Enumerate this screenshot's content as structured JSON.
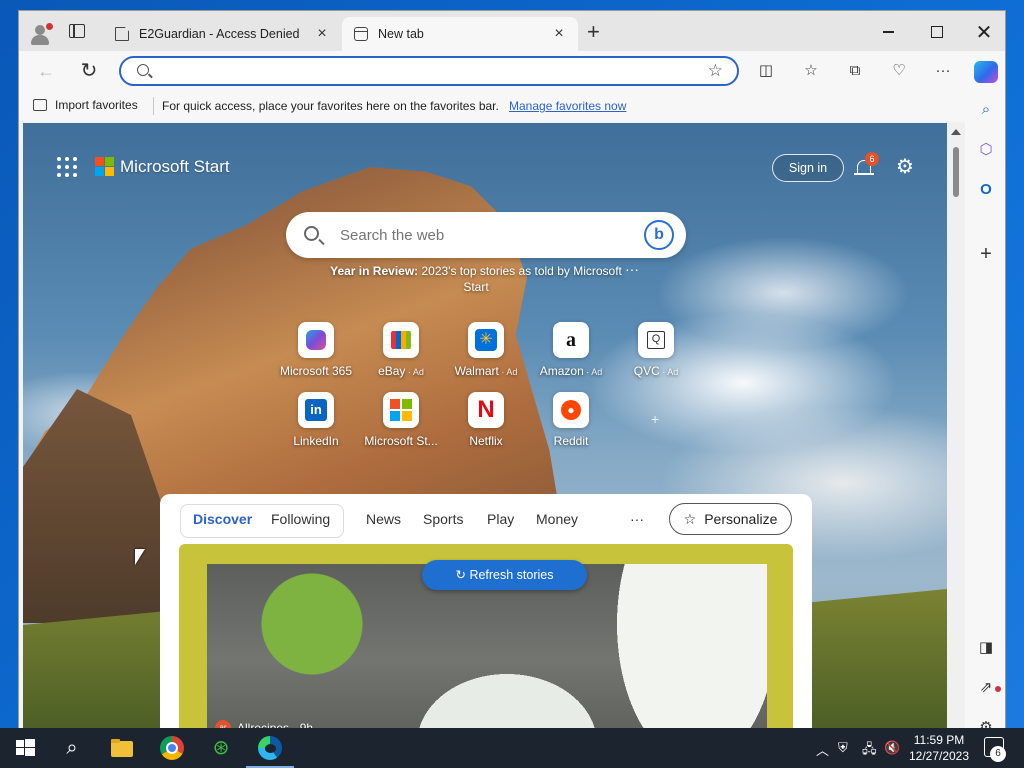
{
  "browser": {
    "tabs": [
      {
        "label": "E2Guardian - Access Denied",
        "active": false
      },
      {
        "label": "New tab",
        "active": true
      }
    ],
    "address_value": "",
    "favorites_bar": {
      "import_label": "Import favorites",
      "hint": "For quick access, place your favorites here on the favorites bar.",
      "manage_link": "Manage favorites now"
    }
  },
  "start_page": {
    "brand": "Microsoft Start",
    "sign_in": "Sign in",
    "notification_count": "6",
    "search_placeholder": "Search the web",
    "year_in_review": {
      "bold": "Year in Review:",
      "text": " 2023's top stories as told by Microsoft Start"
    },
    "quick_links": [
      {
        "label": "Microsoft 365",
        "ad": ""
      },
      {
        "label": "eBay",
        "ad": " · Ad"
      },
      {
        "label": "Walmart",
        "ad": " · Ad"
      },
      {
        "label": "Amazon",
        "ad": " · Ad"
      },
      {
        "label": "QVC",
        "ad": " · Ad"
      },
      {
        "label": "LinkedIn",
        "ad": ""
      },
      {
        "label": "Microsoft St...",
        "ad": ""
      },
      {
        "label": "Netflix",
        "ad": ""
      },
      {
        "label": "Reddit",
        "ad": ""
      }
    ],
    "feed_tabs": {
      "discover": "Discover",
      "following": "Following",
      "news": "News",
      "sports": "Sports",
      "play": "Play",
      "money": "Money",
      "more": "···"
    },
    "personalize": "Personalize",
    "refresh_stories": "Refresh stories",
    "story": {
      "source": "Allrecipes",
      "age": "· 9h",
      "source_icon_text": "ar"
    }
  },
  "taskbar": {
    "time": "11:59 PM",
    "date": "12/27/2023",
    "notification_count": "6"
  },
  "colors": {
    "accent": "#2b63c8",
    "feed_card": "#c7c33a",
    "refresh_button": "#1f6fd1"
  }
}
